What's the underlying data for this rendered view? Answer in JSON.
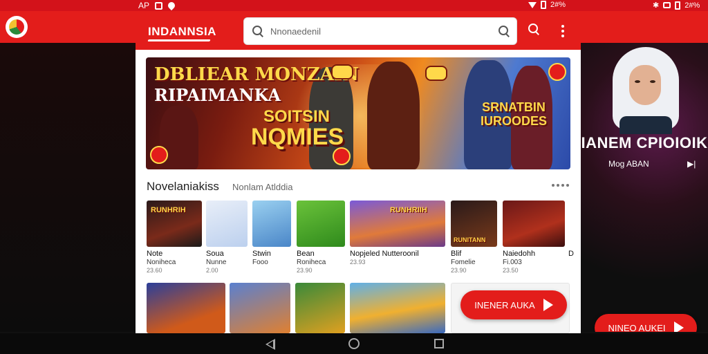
{
  "status_bar": {
    "left_text": "AP",
    "right_text": "2#%"
  },
  "app": {
    "logo": "INDANNSIA",
    "search_placeholder": "Nnonaedenil"
  },
  "banner": {
    "title_line1": "DBLIEAR MONZAIN",
    "title_line2": "RIPAIMANKA",
    "center_line1": "SOITSIN",
    "center_line2": "NQMIES",
    "right_line1": "SRNATBIN",
    "right_line2": "IUROODES"
  },
  "section": {
    "title": "Novelaniakiss",
    "subtitle": "Nonlam Atlddia"
  },
  "games": [
    {
      "tile_label": "RUNHRIH",
      "name": "Note",
      "sub": "Noniheca",
      "size": "23.60"
    },
    {
      "tile_label": "",
      "name": "Soua",
      "sub": "Nunne",
      "size": "2.00"
    },
    {
      "tile_label": "",
      "name": "Stwin",
      "sub": "Fooo",
      "size": ""
    },
    {
      "tile_label": "",
      "name": "Bean",
      "sub": "Roniheca",
      "size": "23.90"
    },
    {
      "tile_label": "RUNHRIIH",
      "name": "Nopjeled Nutteroonil",
      "sub": "",
      "size": "23.93"
    },
    {
      "tile_label": "RUNITANN",
      "name": "Blif",
      "sub": "Fomelie",
      "size": "23.90"
    },
    {
      "tile_label": "",
      "name": "Naiedohh",
      "sub": "Fi.003",
      "size": "23.50"
    },
    {
      "tile_label": "",
      "name": "D",
      "sub": "",
      "size": ""
    }
  ],
  "cta_label": "INENER AUKA",
  "side_promo": {
    "title": "IANEM CPIOIOIK",
    "subtitle": "Mog ABAN",
    "button_label": "NINEO AUKEI"
  },
  "colors": {
    "brand_red": "#e31d1b",
    "accent_yellow": "#ffd94a"
  }
}
